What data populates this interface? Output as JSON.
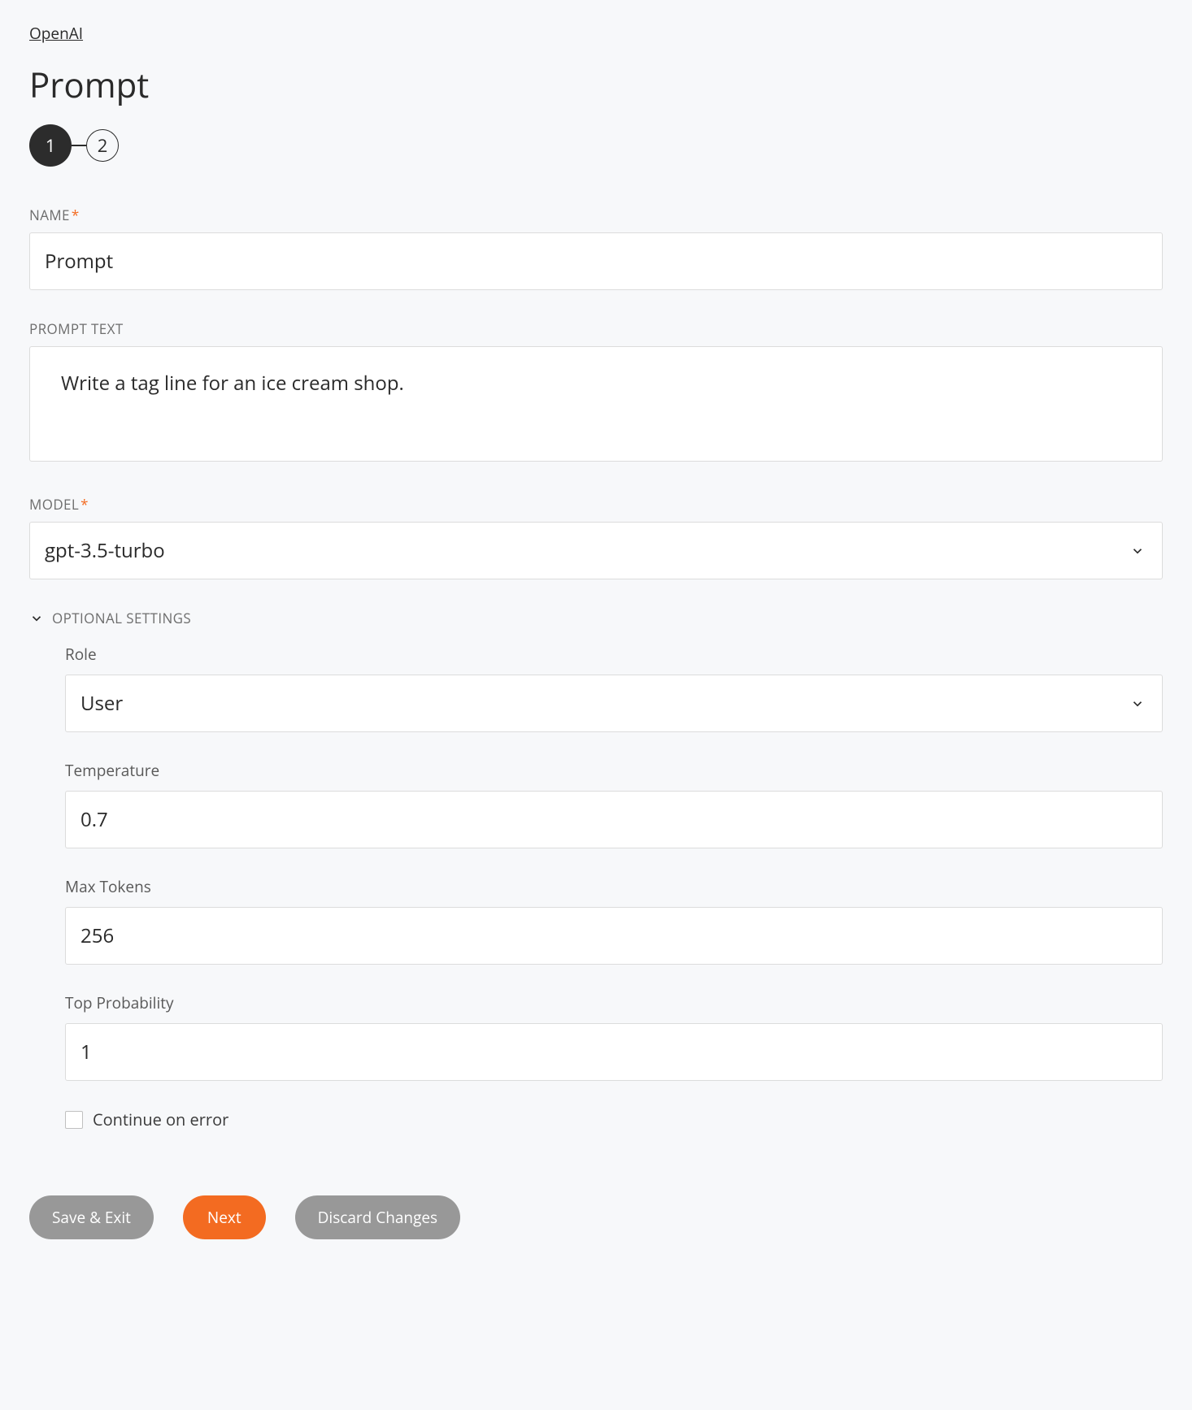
{
  "breadcrumb": {
    "label": "OpenAI"
  },
  "page_title": "Prompt",
  "stepper": {
    "steps": [
      "1",
      "2"
    ],
    "active_index": 0
  },
  "fields": {
    "name": {
      "label": "NAME",
      "required": true,
      "value": "Prompt"
    },
    "prompt_text": {
      "label": "PROMPT TEXT",
      "required": false,
      "value": "Write a tag line for an ice cream shop."
    },
    "model": {
      "label": "MODEL",
      "required": true,
      "value": "gpt-3.5-turbo"
    }
  },
  "optional": {
    "header": "OPTIONAL SETTINGS",
    "role": {
      "label": "Role",
      "value": "User"
    },
    "temperature": {
      "label": "Temperature",
      "value": "0.7"
    },
    "max_tokens": {
      "label": "Max Tokens",
      "value": "256"
    },
    "top_p": {
      "label": "Top Probability",
      "value": "1"
    },
    "continue_on_error": {
      "label": "Continue on error",
      "checked": false
    }
  },
  "footer": {
    "save_exit": "Save & Exit",
    "next": "Next",
    "discard": "Discard Changes"
  }
}
